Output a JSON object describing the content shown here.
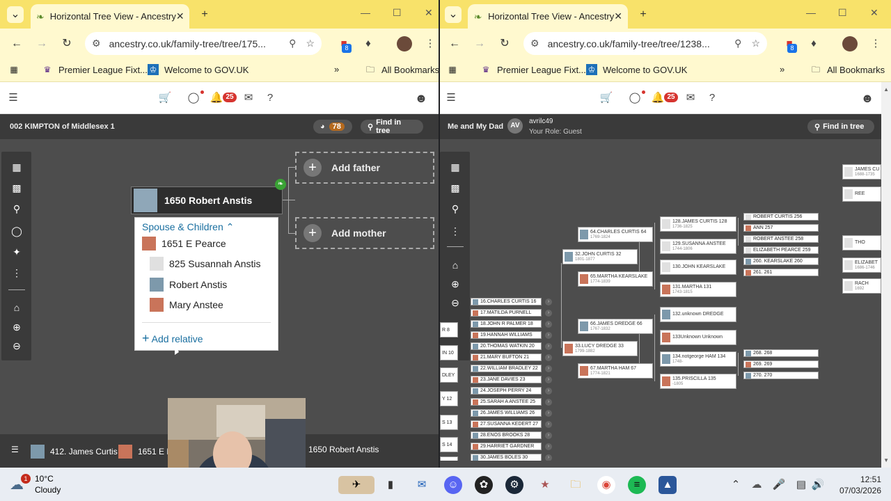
{
  "left": {
    "tab_title": "Horizontal Tree View - Ancestry",
    "url": "ancestry.co.uk/family-tree/tree/175...",
    "ext_badge": "8",
    "bookmarks": [
      "Premier League Fixt...",
      "Welcome to GOV.UK"
    ],
    "all_bookmarks": "All Bookmarks",
    "notif_count": "25",
    "tree_name": "002 KIMPTON of Middlesex 1",
    "hints_count": "78",
    "find_in_tree": "Find in tree",
    "focus_person": "1650 Robert Anstis",
    "add_father": "Add father",
    "add_mother": "Add mother",
    "popup": {
      "heading": "Spouse & Children",
      "spouse": "1651 E Pearce",
      "children": [
        "825 Susannah Anstis",
        "Robert Anstis",
        "Mary Anstee"
      ],
      "add_relative": "Add relative"
    },
    "bottom_bar": [
      "412. James Curtis",
      "1651 E Pe",
      "1650 Robert Anstis"
    ]
  },
  "right": {
    "tab_title": "Horizontal Tree View - Ancestry",
    "url": "ancestry.co.uk/family-tree/tree/1238...",
    "ext_badge": "8",
    "bookmarks": [
      "Premier League Fixt...",
      "Welcome to GOV.UK"
    ],
    "all_bookmarks": "All Bookmarks",
    "notif_count": "25",
    "tree_name": "Me and My Dad",
    "owner_initials": "AV",
    "owner_name": "avrilc49",
    "owner_role": "Your Role: Guest",
    "find_in_tree": "Find in tree",
    "gen4_cards": [
      {
        "name": "64.CHARLES CURTIS 64",
        "dates": "1769-1824",
        "g": "m"
      },
      {
        "name": "32.JOHN CURTIS 32",
        "dates": "1801-1877",
        "g": "m"
      },
      {
        "name": "65.MARTHA KEARSLAKE",
        "dates": "1774-1839",
        "g": "f"
      },
      {
        "name": "66.JAMES DREDGE 66",
        "dates": "1767-1832",
        "g": "m"
      },
      {
        "name": "33.LUCY DREDGE 33",
        "dates": "1799-1882",
        "g": "f"
      },
      {
        "name": "67.MARTHA HAM 67",
        "dates": "1774-1821",
        "g": "f"
      }
    ],
    "gen5_cards": [
      {
        "name": "128.JAMES CURTIS 128",
        "dates": "1736-1825",
        "g": "u"
      },
      {
        "name": "129.SUSANNA ANSTEE",
        "dates": "1744-1806",
        "g": "u"
      },
      {
        "name": "130.JOHN KEARSLAKE",
        "dates": "",
        "g": "u"
      },
      {
        "name": "131.MARTHA 131",
        "dates": "1743-1815",
        "g": "f"
      },
      {
        "name": "132.unknown DREDGE",
        "dates": "",
        "g": "m"
      },
      {
        "name": "133Unknown Unknown",
        "dates": "",
        "g": "f"
      },
      {
        "name": "134.notgeorge HAM 134",
        "dates": "1748-",
        "g": "m"
      },
      {
        "name": "135.PRISCILLA 135",
        "dates": "-1805",
        "g": "f"
      }
    ],
    "gen6_cards": [
      {
        "name": "ROBERT CURTIS 256",
        "g": "u"
      },
      {
        "name": "ANN 257",
        "g": "f"
      },
      {
        "name": "ROBERT ANSTEE 258",
        "g": "u"
      },
      {
        "name": "ELIZABETH PEARCE 259",
        "g": "u"
      },
      {
        "name": "260. KEARSLAKE 260",
        "g": "m"
      },
      {
        "name": "261. 261",
        "g": "f"
      },
      {
        "name": "268. 268",
        "g": "m"
      },
      {
        "name": "269. 269",
        "g": "f"
      },
      {
        "name": "270. 270",
        "g": "m"
      }
    ],
    "gen7_cards": [
      {
        "name": "JAMES CU",
        "dates": "1688-1735"
      },
      {
        "name": "REE",
        "dates": ""
      },
      {
        "name": "THO",
        "dates": ""
      },
      {
        "name": "ELIZABET",
        "dates": "1686-1746"
      },
      {
        "name": "RACH",
        "dates": "1692"
      }
    ],
    "list_cards": [
      "16.CHARLES CURTIS 16",
      "17.MATILDA PURNELL",
      "18.JOHN R PALMER 18",
      "19.HANNAH WILLIAMS",
      "20.THOMAS WATKIN 20",
      "21.MARY BUFTON 21",
      "22.WILLIAM BRADLEY 22",
      "23.JANE DAVIES 23",
      "24.JOSEPH PERRY 24",
      "25.SARAH A ANSTEE 25",
      "26.JAMES WILLIAMS 26",
      "27.SUSANNA KEDERT 27",
      "28.ENOS BROOKS 28",
      "29.HARRIET GARDNER",
      "30.JAMES BOLES 30"
    ],
    "left_cut_cards": [
      "R 8",
      "IN 10",
      "DLEY",
      "Y 12",
      "S 13",
      "S 14",
      "15"
    ]
  },
  "taskbar": {
    "weather_badge": "1",
    "temperature": "10°C",
    "condition": "Cloudy",
    "time": "12:51",
    "date": "07/03/2026"
  }
}
